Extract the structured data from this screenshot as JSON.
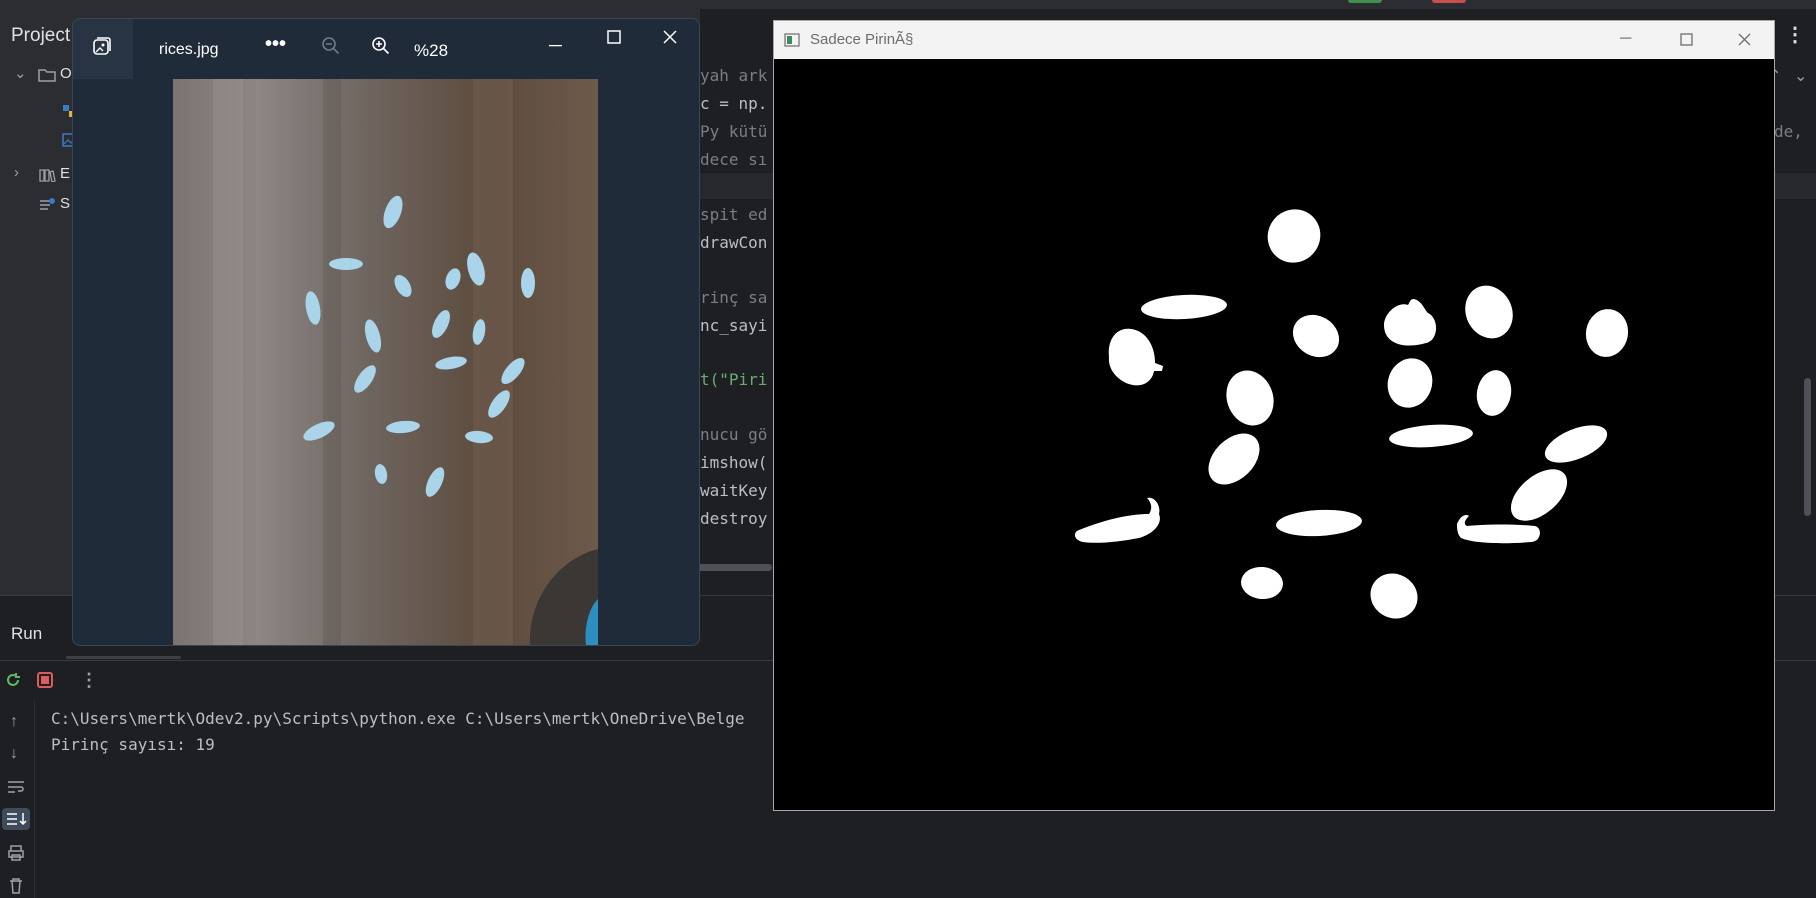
{
  "ide": {
    "project_title": "Project",
    "tree": [
      {
        "name": "root-folder",
        "label": "O"
      },
      {
        "name": "external-libraries",
        "label": "E"
      },
      {
        "name": "scratches",
        "label": "S"
      }
    ],
    "code_lines": [
      "yah ark",
      "c = np.",
      "Py kütü",
      "dece sı",
      "",
      "spit ed",
      "drawCon",
      "",
      "rinç sa",
      "nc_sayi",
      "",
      "t(\"Piri",
      "",
      "nucu gö",
      "imshow(",
      "waitKey",
      "destroy"
    ],
    "right_edge_text": "de,",
    "run": {
      "title": "Run",
      "output": [
        "C:\\Users\\mertk\\Odev2.py\\Scripts\\python.exe C:\\Users\\mertk\\OneDrive\\Belge",
        "Pirinç sayısı: 19"
      ]
    }
  },
  "photos_window": {
    "filename": "rices.jpg",
    "zoom_level": "%28",
    "more_label": "•••"
  },
  "opencv_window": {
    "title": "Sadece PirinÃ§"
  },
  "colors": {
    "ide_bg": "#1e1f22",
    "panel_bg": "#2b2d30",
    "photos_bg": "#202b39",
    "rice_blue": "#a9d4ea"
  }
}
